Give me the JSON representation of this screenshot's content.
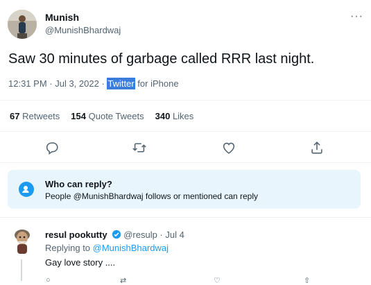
{
  "author": {
    "name": "Munish",
    "handle": "@MunishBhardwaj",
    "avatar_icon": "profile-photo"
  },
  "tweet": {
    "text": "Saw 30 minutes of garbage called RRR last night.",
    "time": "12:31 PM",
    "date": "Jul 3, 2022",
    "source_highlight": "Twitter",
    "source_rest": " for iPhone",
    "sep": " · "
  },
  "stats": {
    "retweets_count": "67",
    "retweets_label": "Retweets",
    "quote_count": "154",
    "quote_label": "Quote Tweets",
    "likes_count": "340",
    "likes_label": "Likes"
  },
  "actions": [
    "reply-icon",
    "retweet-icon",
    "like-icon",
    "share-icon"
  ],
  "who_can_reply": {
    "title": "Who can reply?",
    "subtitle": "People @MunishBhardwaj follows or mentioned can reply"
  },
  "reply": {
    "name": "resul pookutty",
    "handle": "@resulp",
    "date": "Jul 4",
    "sep": " · ",
    "replying_prefix": "Replying to ",
    "replying_to": "@MunishBhardwaj",
    "text": "Gay love story ...."
  },
  "colors": {
    "accent": "#1d9bf0",
    "selection": "#3b7ddd",
    "secondary_text": "#536471",
    "reply_box_bg": "#e8f5fd"
  }
}
